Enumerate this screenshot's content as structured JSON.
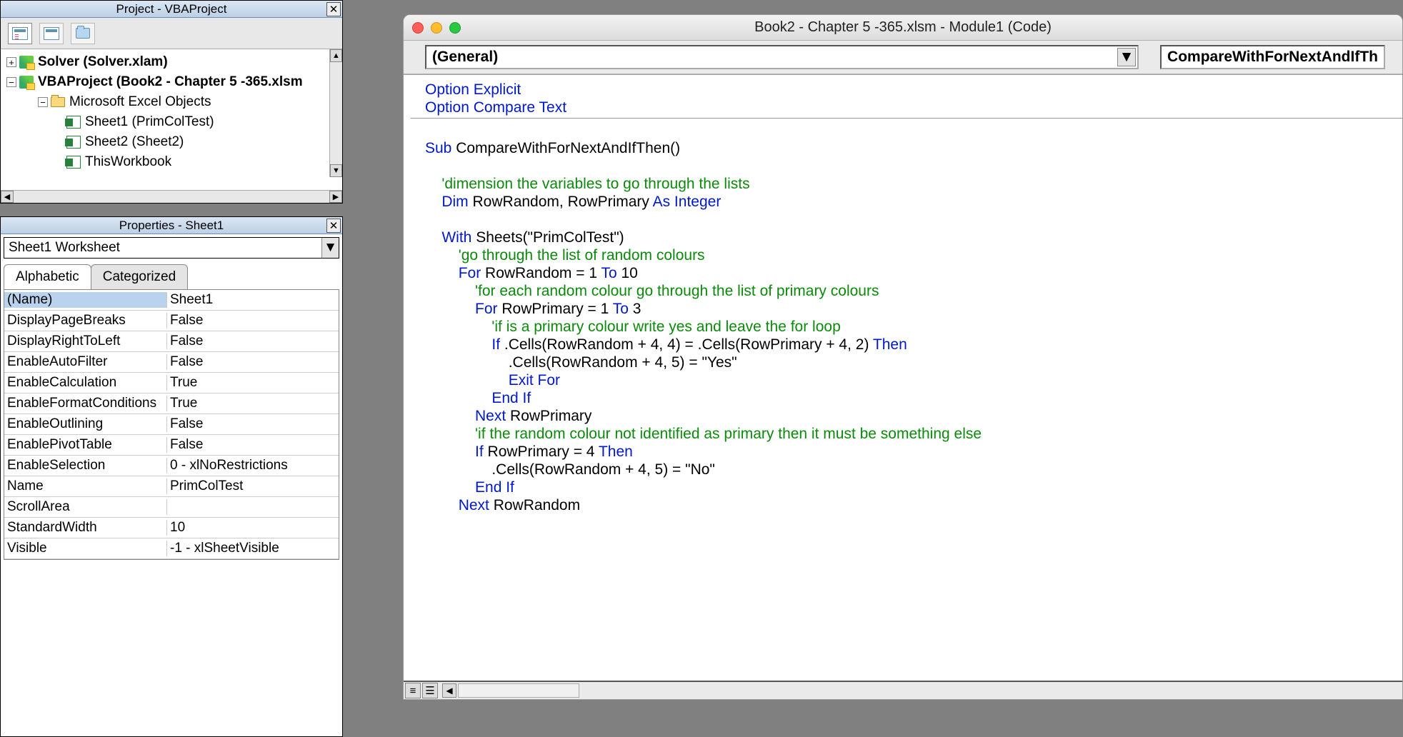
{
  "project_panel": {
    "title": "Project - VBAProject",
    "tree": {
      "solver": "Solver (Solver.xlam)",
      "vbaproject": "VBAProject (Book2 - Chapter 5 -365.xlsm",
      "excel_objects": "Microsoft Excel Objects",
      "sheet1": "Sheet1 (PrimColTest)",
      "sheet2": "Sheet2 (Sheet2)",
      "thisworkbook": "ThisWorkbook"
    }
  },
  "props_panel": {
    "title": "Properties - Sheet1",
    "object_selector": "Sheet1 Worksheet",
    "tab_alpha": "Alphabetic",
    "tab_cat": "Categorized",
    "rows": [
      {
        "name": "(Name)",
        "value": "Sheet1"
      },
      {
        "name": "DisplayPageBreaks",
        "value": "False"
      },
      {
        "name": "DisplayRightToLeft",
        "value": "False"
      },
      {
        "name": "EnableAutoFilter",
        "value": "False"
      },
      {
        "name": "EnableCalculation",
        "value": "True"
      },
      {
        "name": "EnableFormatConditions",
        "value": "True"
      },
      {
        "name": "EnableOutlining",
        "value": "False"
      },
      {
        "name": "EnablePivotTable",
        "value": "False"
      },
      {
        "name": "EnableSelection",
        "value": "0 - xlNoRestrictions"
      },
      {
        "name": "Name",
        "value": "PrimColTest"
      },
      {
        "name": "ScrollArea",
        "value": ""
      },
      {
        "name": "StandardWidth",
        "value": "10"
      },
      {
        "name": "Visible",
        "value": "-1 - xlSheetVisible"
      }
    ]
  },
  "code_window": {
    "title": "Book2 - Chapter 5 -365.xlsm - Module1 (Code)",
    "dd_left": "(General)",
    "dd_right": "CompareWithForNextAndIfTh",
    "lines": [
      [
        {
          "c": "kw",
          "t": "Option Explicit"
        }
      ],
      [
        {
          "c": "kw",
          "t": "Option Compare Text"
        }
      ],
      "DIV",
      [],
      [
        {
          "c": "kw",
          "t": "Sub "
        },
        {
          "c": "tx",
          "t": "CompareWithForNextAndIfThen()"
        }
      ],
      [],
      [
        {
          "c": "tx",
          "t": "    "
        },
        {
          "c": "cm",
          "t": "'dimension the variables to go through the lists"
        }
      ],
      [
        {
          "c": "tx",
          "t": "    "
        },
        {
          "c": "kw",
          "t": "Dim "
        },
        {
          "c": "tx",
          "t": "RowRandom, RowPrimary "
        },
        {
          "c": "kw",
          "t": "As Integer"
        }
      ],
      [],
      [
        {
          "c": "tx",
          "t": "    "
        },
        {
          "c": "kw",
          "t": "With "
        },
        {
          "c": "tx",
          "t": "Sheets(\"PrimColTest\")"
        }
      ],
      [
        {
          "c": "tx",
          "t": "        "
        },
        {
          "c": "cm",
          "t": "'go through the list of random colours"
        }
      ],
      [
        {
          "c": "tx",
          "t": "        "
        },
        {
          "c": "kw",
          "t": "For "
        },
        {
          "c": "tx",
          "t": "RowRandom = 1 "
        },
        {
          "c": "kw",
          "t": "To "
        },
        {
          "c": "tx",
          "t": "10"
        }
      ],
      [
        {
          "c": "tx",
          "t": "            "
        },
        {
          "c": "cm",
          "t": "'for each random colour go through the list of primary colours"
        }
      ],
      [
        {
          "c": "tx",
          "t": "            "
        },
        {
          "c": "kw",
          "t": "For "
        },
        {
          "c": "tx",
          "t": "RowPrimary = 1 "
        },
        {
          "c": "kw",
          "t": "To "
        },
        {
          "c": "tx",
          "t": "3"
        }
      ],
      [
        {
          "c": "tx",
          "t": "                "
        },
        {
          "c": "cm",
          "t": "'if is a primary colour write yes and leave the for loop"
        }
      ],
      [
        {
          "c": "tx",
          "t": "                "
        },
        {
          "c": "kw",
          "t": "If "
        },
        {
          "c": "tx",
          "t": ".Cells(RowRandom + 4, 4) = .Cells(RowPrimary + 4, 2) "
        },
        {
          "c": "kw",
          "t": "Then"
        }
      ],
      [
        {
          "c": "tx",
          "t": "                    .Cells(RowRandom + 4, 5) = \"Yes\""
        }
      ],
      [
        {
          "c": "tx",
          "t": "                    "
        },
        {
          "c": "kw",
          "t": "Exit For"
        }
      ],
      [
        {
          "c": "tx",
          "t": "                "
        },
        {
          "c": "kw",
          "t": "End If"
        }
      ],
      [
        {
          "c": "tx",
          "t": "            "
        },
        {
          "c": "kw",
          "t": "Next "
        },
        {
          "c": "tx",
          "t": "RowPrimary"
        }
      ],
      [
        {
          "c": "tx",
          "t": "            "
        },
        {
          "c": "cm",
          "t": "'if the random colour not identified as primary then it must be something else"
        }
      ],
      [
        {
          "c": "tx",
          "t": "            "
        },
        {
          "c": "kw",
          "t": "If "
        },
        {
          "c": "tx",
          "t": "RowPrimary = 4 "
        },
        {
          "c": "kw",
          "t": "Then"
        }
      ],
      [
        {
          "c": "tx",
          "t": "                .Cells(RowRandom + 4, 5) = \"No\""
        }
      ],
      [
        {
          "c": "tx",
          "t": "            "
        },
        {
          "c": "kw",
          "t": "End If"
        }
      ],
      [
        {
          "c": "tx",
          "t": "        "
        },
        {
          "c": "kw",
          "t": "Next "
        },
        {
          "c": "tx",
          "t": "RowRandom"
        }
      ]
    ]
  }
}
